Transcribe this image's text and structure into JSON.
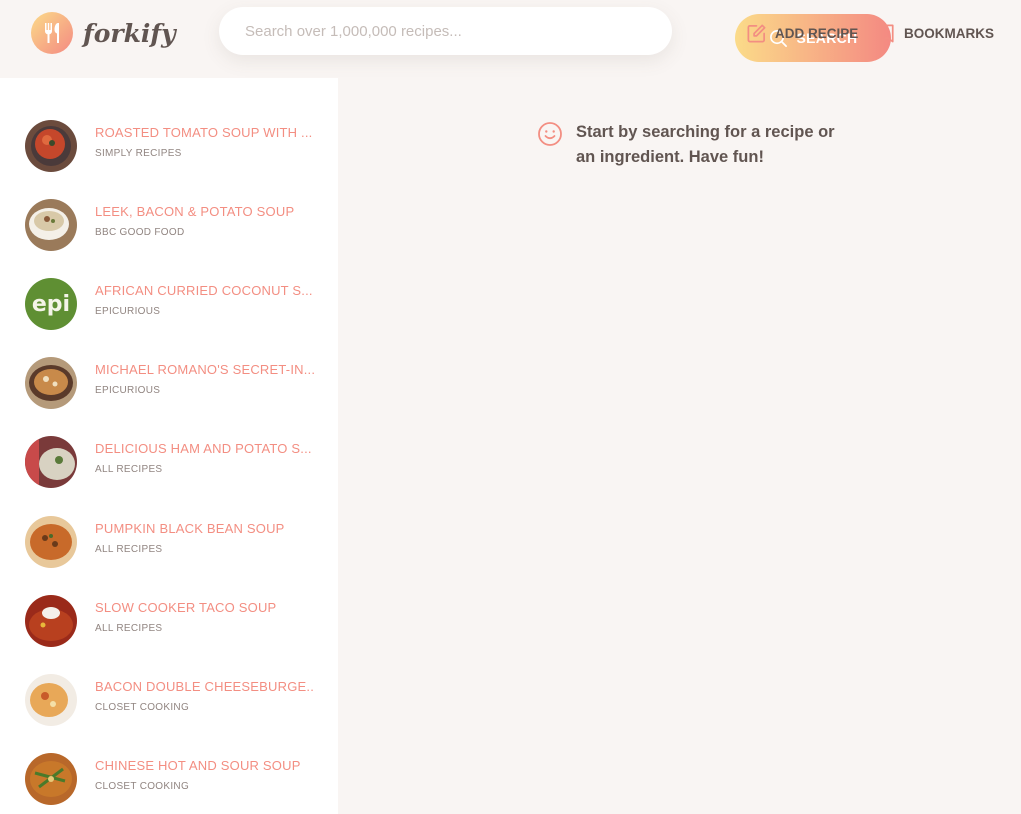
{
  "header": {
    "logo_text": "forkify",
    "search": {
      "placeholder": "Search over 1,000,000 recipes...",
      "value": "",
      "button_label": "SEARCH"
    },
    "add_recipe_label": "ADD RECIPE",
    "bookmarks_label": "BOOKMARKS"
  },
  "results": [
    {
      "title": "ROASTED TOMATO SOUP WITH ...",
      "publisher": "SIMPLY RECIPES",
      "thumb": "tomato-soup"
    },
    {
      "title": "LEEK, BACON & POTATO SOUP",
      "publisher": "BBC GOOD FOOD",
      "thumb": "leek-soup"
    },
    {
      "title": "AFRICAN CURRIED COCONUT S...",
      "publisher": "EPICURIOUS",
      "thumb": "epi-logo"
    },
    {
      "title": "MICHAEL ROMANO'S SECRET-IN...",
      "publisher": "EPICURIOUS",
      "thumb": "romano-soup"
    },
    {
      "title": "DELICIOUS HAM AND POTATO S...",
      "publisher": "ALL RECIPES",
      "thumb": "ham-soup"
    },
    {
      "title": "PUMPKIN BLACK BEAN SOUP",
      "publisher": "ALL RECIPES",
      "thumb": "pumpkin-soup"
    },
    {
      "title": "SLOW COOKER TACO SOUP",
      "publisher": "ALL RECIPES",
      "thumb": "taco-soup"
    },
    {
      "title": "BACON DOUBLE CHEESEBURGE...",
      "publisher": "CLOSET COOKING",
      "thumb": "cheeseburger-soup"
    },
    {
      "title": "CHINESE HOT AND SOUR SOUP",
      "publisher": "CLOSET COOKING",
      "thumb": "hot-sour-soup"
    }
  ],
  "main": {
    "message": "Start by searching for a recipe or an ingredient. Have fun!",
    "message_icon": "smile-icon"
  },
  "colors": {
    "accent": "#f38e82",
    "gradient_start": "#fbdb89",
    "gradient_end": "#f48982",
    "background": "#f9f5f3",
    "text": "#615551"
  }
}
